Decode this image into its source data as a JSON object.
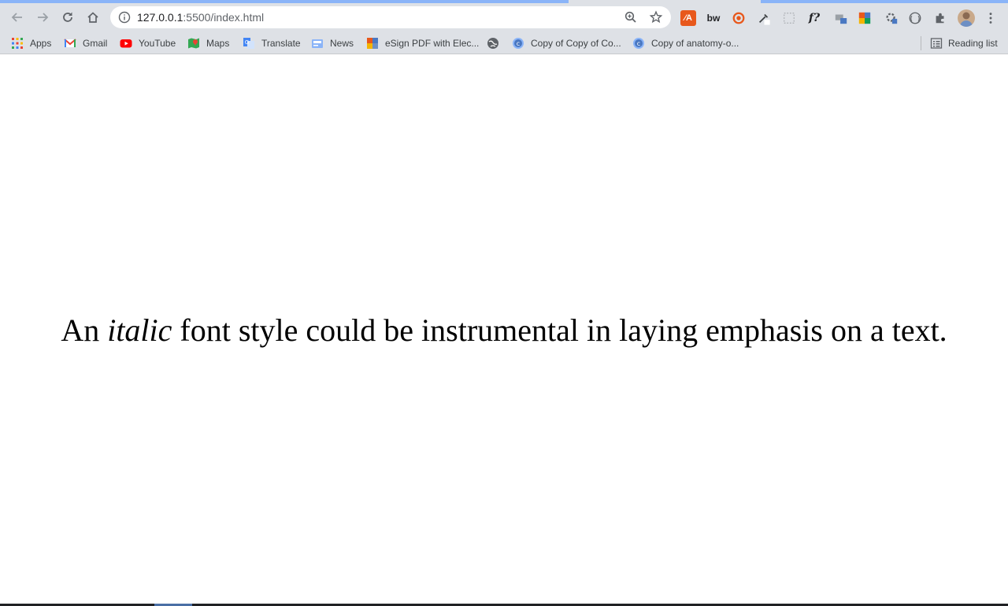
{
  "browser": {
    "url_host": "127.0.0.1",
    "url_path": ":5500/index.html",
    "extension_f_label": "f?",
    "extension_bw_label": "bw"
  },
  "bookmarks": [
    {
      "label": "Apps",
      "icon": "apps-grid-icon"
    },
    {
      "label": "Gmail",
      "icon": "gmail-icon"
    },
    {
      "label": "YouTube",
      "icon": "youtube-icon"
    },
    {
      "label": "Maps",
      "icon": "maps-icon"
    },
    {
      "label": "Translate",
      "icon": "translate-icon"
    },
    {
      "label": "News",
      "icon": "news-icon"
    },
    {
      "label": "eSign PDF with Elec...",
      "icon": "esign-icon"
    },
    {
      "label": "",
      "icon": "globe-icon"
    },
    {
      "label": "Copy of Copy of Co...",
      "icon": "site-icon"
    },
    {
      "label": "Copy of anatomy-o...",
      "icon": "site-icon"
    }
  ],
  "reading_list": {
    "label": "Reading list"
  },
  "page": {
    "before": "An ",
    "italic": "italic",
    "after": " font style could be instrumental in laying emphasis on a text."
  },
  "colors": {
    "toolbar": "#dee1e6",
    "tab_accent": "#8ab4f8",
    "text": "#000000"
  }
}
